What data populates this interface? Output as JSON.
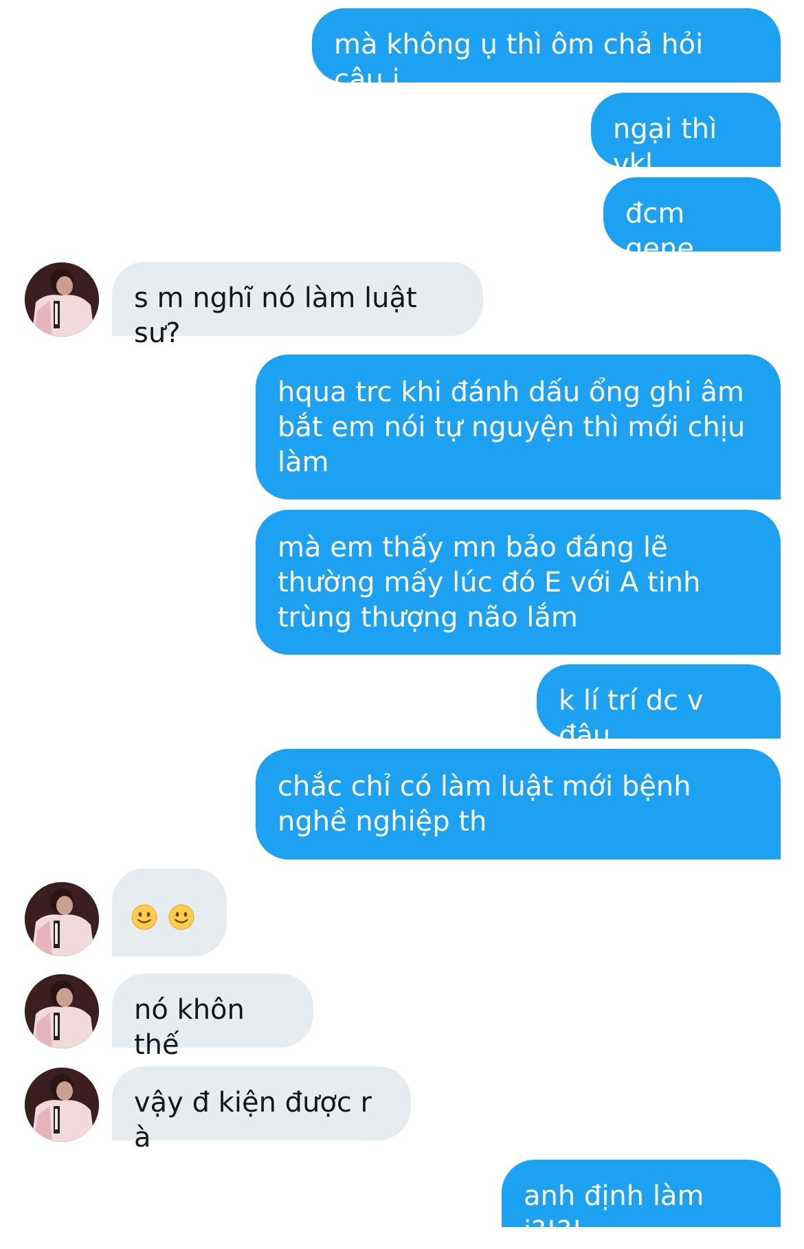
{
  "conversation": {
    "messages": [
      {
        "dir": "out",
        "text": "mà không ụ thì ôm chả hỏi câu j"
      },
      {
        "dir": "out",
        "text": "ngại thì vkl"
      },
      {
        "dir": "out",
        "text": "đcm gene"
      },
      {
        "dir": "in",
        "text": "s m nghĩ nó làm luật sư?"
      },
      {
        "dir": "out",
        "text": "hqua trc khi đánh dấu ổng ghi âm bắt em nói tự nguyện thì mới chịu làm"
      },
      {
        "dir": "out",
        "text": "mà em thấy mn bảo đáng lẽ thường mấy lúc đó E với A tinh trùng thượng não lắm"
      },
      {
        "dir": "out",
        "text": "k lí trí dc v đâu"
      },
      {
        "dir": "out",
        "text": "chắc chỉ có làm luật mới bệnh nghề nghiệp th"
      },
      {
        "dir": "in",
        "emoji": [
          "slightly-smiling-face",
          "slightly-smiling-face"
        ]
      },
      {
        "dir": "in",
        "text": "nó khôn thế"
      },
      {
        "dir": "in",
        "text": "vậy đ kiện được r à"
      },
      {
        "dir": "out",
        "text": "anh định làm j?!?!"
      }
    ]
  },
  "avatar": {
    "icon": "contact-avatar"
  },
  "colors": {
    "outgoing_bubble": "#1da1f2",
    "outgoing_text": "#ffffff",
    "incoming_bubble": "#e6ecf0",
    "incoming_text": "#14171a"
  }
}
